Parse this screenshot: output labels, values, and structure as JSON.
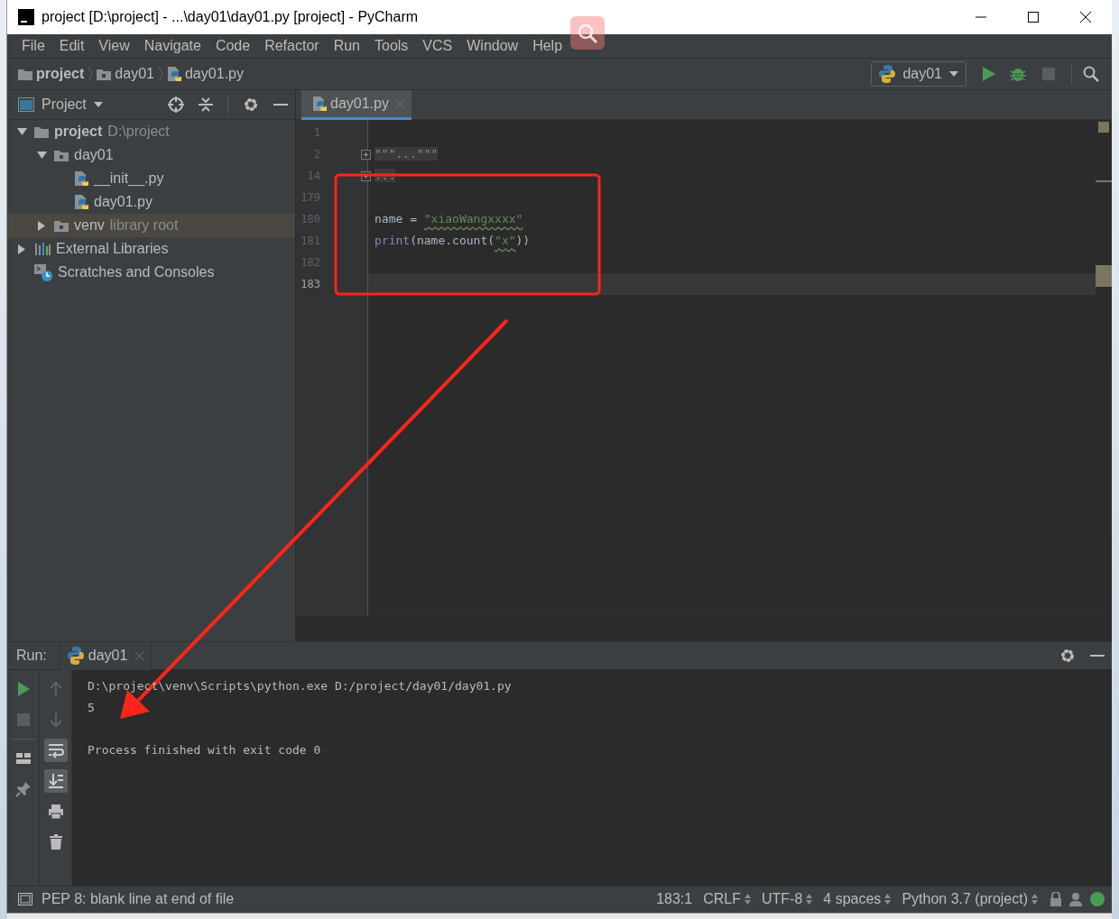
{
  "window": {
    "title": "project [D:\\project] - ...\\day01\\day01.py [project] - PyCharm"
  },
  "menu": [
    "File",
    "Edit",
    "View",
    "Navigate",
    "Code",
    "Refactor",
    "Run",
    "Tools",
    "VCS",
    "Window",
    "Help"
  ],
  "breadcrumbs": [
    {
      "label": "project",
      "kind": "folder",
      "bold": true
    },
    {
      "label": "day01",
      "kind": "module",
      "bold": false
    },
    {
      "label": "day01.py",
      "kind": "python",
      "bold": false
    }
  ],
  "run_config": {
    "label": "day01"
  },
  "project_panel": {
    "title": "Project",
    "tree": [
      {
        "label": "project",
        "hint": "D:\\project",
        "kind": "folder",
        "bold": true,
        "expanded": true,
        "selected": false,
        "children": [
          {
            "label": "day01",
            "kind": "module",
            "bold": false,
            "expanded": true,
            "selected": false,
            "children": [
              {
                "label": "__init__.py",
                "kind": "python",
                "bold": false,
                "selected": false
              },
              {
                "label": "day01.py",
                "kind": "python",
                "bold": false,
                "selected": false
              }
            ]
          },
          {
            "label": "venv",
            "hint": "library root",
            "kind": "module",
            "bold": false,
            "expanded": false,
            "selected": true
          }
        ]
      },
      {
        "label": "External Libraries",
        "kind": "libraries",
        "bold": false,
        "expanded": false,
        "selected": false
      },
      {
        "label": "Scratches and Consoles",
        "kind": "scratches",
        "bold": false,
        "selected": false
      }
    ]
  },
  "editor_tabs": [
    {
      "label": "day01.py",
      "selected": true
    }
  ],
  "editor": {
    "lines": [
      {
        "number": "1",
        "current": false
      },
      {
        "number": "2",
        "current": false,
        "segments": [
          {
            "text": "\"\"\"...\"\"\"",
            "kind": "folded"
          }
        ]
      },
      {
        "number": "14",
        "current": false,
        "segments": [
          {
            "text": "...",
            "kind": "folded"
          }
        ]
      },
      {
        "number": "179",
        "current": false
      },
      {
        "number": "180",
        "current": false,
        "segments": [
          {
            "text": "name = ",
            "kind": "plain"
          },
          {
            "text": "\"xiaoWangxxxx\"",
            "kind": "string"
          }
        ]
      },
      {
        "number": "181",
        "current": false,
        "segments": [
          {
            "text": "print",
            "kind": "builtin"
          },
          {
            "text": "(name.count(",
            "kind": "plain"
          },
          {
            "text": "\"x\"",
            "kind": "string"
          },
          {
            "text": "))",
            "kind": "plain"
          }
        ]
      },
      {
        "number": "182",
        "current": false
      },
      {
        "number": "183",
        "current": true
      }
    ]
  },
  "run_panel": {
    "label": "Run:",
    "tabs": [
      {
        "label": "day01",
        "selected": true
      }
    ],
    "output": [
      {
        "text": "D:\\project\\venv\\Scripts\\python.exe D:/project/day01/day01.py",
        "kind": "command"
      },
      {
        "text": "5",
        "kind": "stdout"
      },
      {
        "text": "Process finished with exit code 0",
        "kind": "exit"
      }
    ]
  },
  "status_bar": {
    "message": "PEP 8: blank line at end of file",
    "items": [
      {
        "label": "183:1",
        "dropdown": false
      },
      {
        "label": "CRLF",
        "dropdown": true
      },
      {
        "label": "UTF-8",
        "dropdown": true
      },
      {
        "label": "4 spaces",
        "dropdown": true
      },
      {
        "label": "Python 3.7 (project)",
        "dropdown": true
      }
    ]
  },
  "annotations": {
    "highlight_box": true,
    "arrow": true
  }
}
